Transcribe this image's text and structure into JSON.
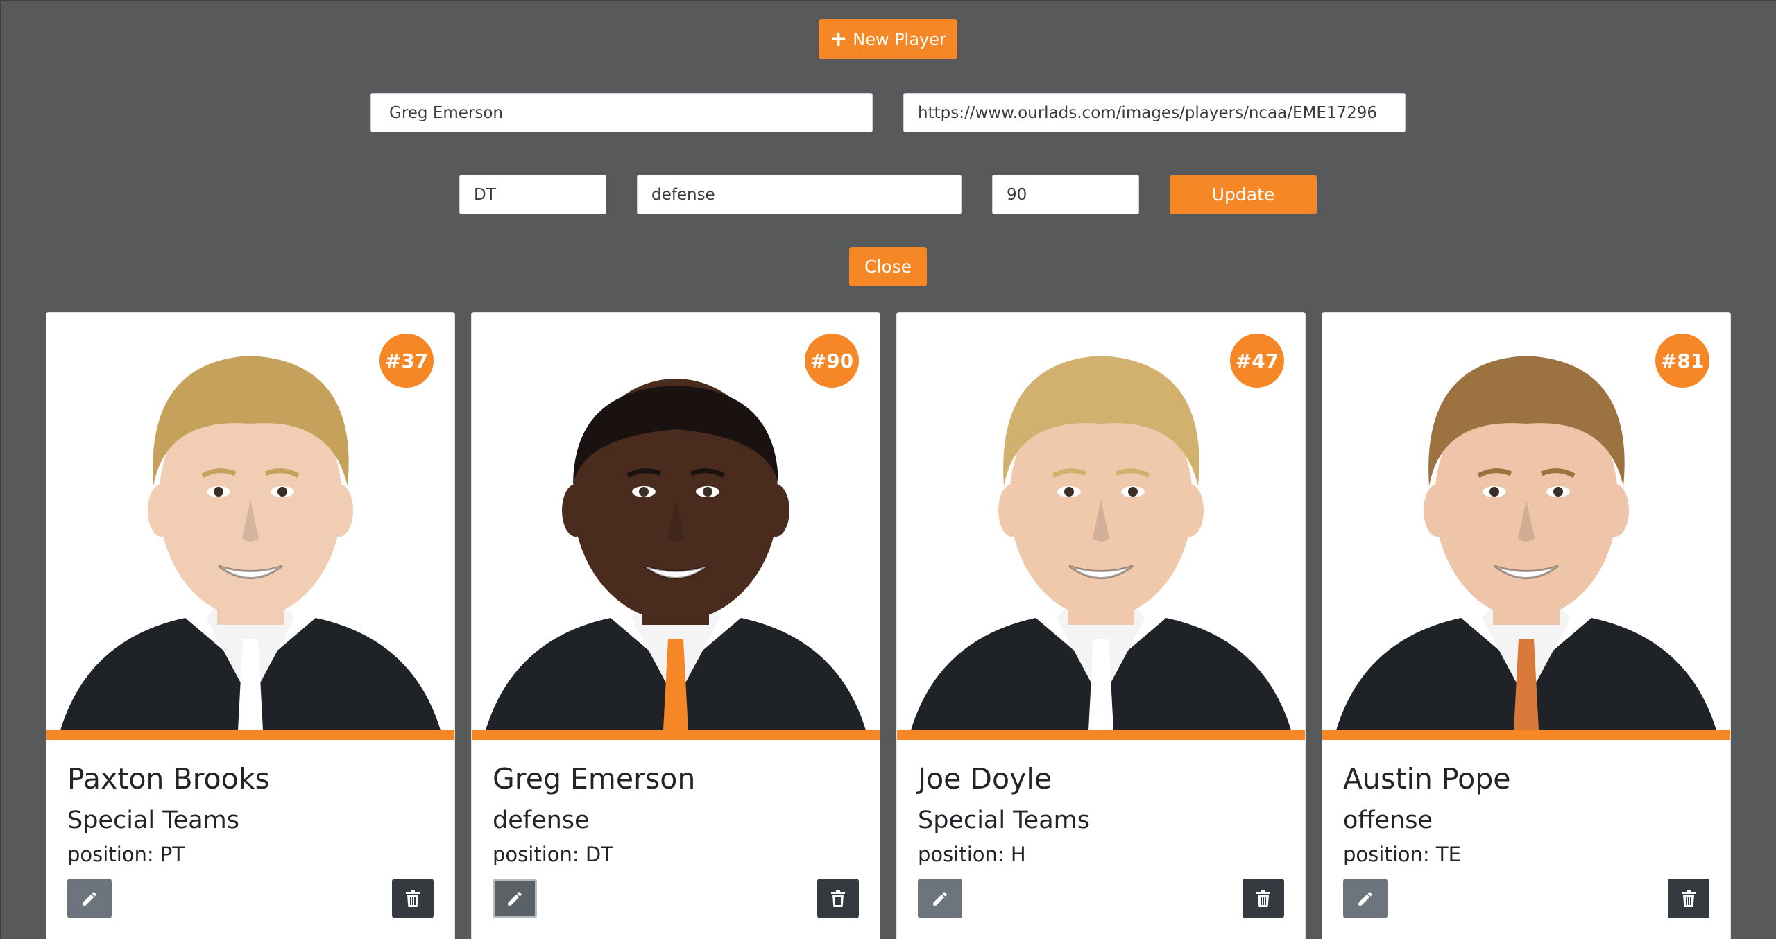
{
  "toolbar": {
    "new_player_label": "New Player",
    "new_player_icon": "plus-icon"
  },
  "form": {
    "name": "Greg Emerson",
    "image_url": "https://www.ourlads.com/images/players/ncaa/EME17296",
    "position": "DT",
    "side": "defense",
    "number": "90",
    "update_label": "Update",
    "close_label": "Close"
  },
  "colors": {
    "accent": "#f68726",
    "background": "#58595b",
    "edit_button": "#6c757d",
    "delete_button": "#343a40"
  },
  "players": [
    {
      "number": "#37",
      "name": "Paxton Brooks",
      "side": "Special Teams",
      "position": "position: PT",
      "skin": "#f1cdb4",
      "hair": "#c6a15b",
      "tie": "#ffffff"
    },
    {
      "number": "#90",
      "name": "Greg Emerson",
      "side": "defense",
      "position": "position: DT",
      "skin": "#4a2c1e",
      "hair": "#1a1210",
      "tie": "#f68726"
    },
    {
      "number": "#47",
      "name": "Joe Doyle",
      "side": "Special Teams",
      "position": "position: H",
      "skin": "#f0c9ad",
      "hair": "#d2b06e",
      "tie": "#ffffff"
    },
    {
      "number": "#81",
      "name": "Austin Pope",
      "side": "offense",
      "position": "position: TE",
      "skin": "#eec5a8",
      "hair": "#9b7240",
      "tie": "#d9793a"
    }
  ]
}
